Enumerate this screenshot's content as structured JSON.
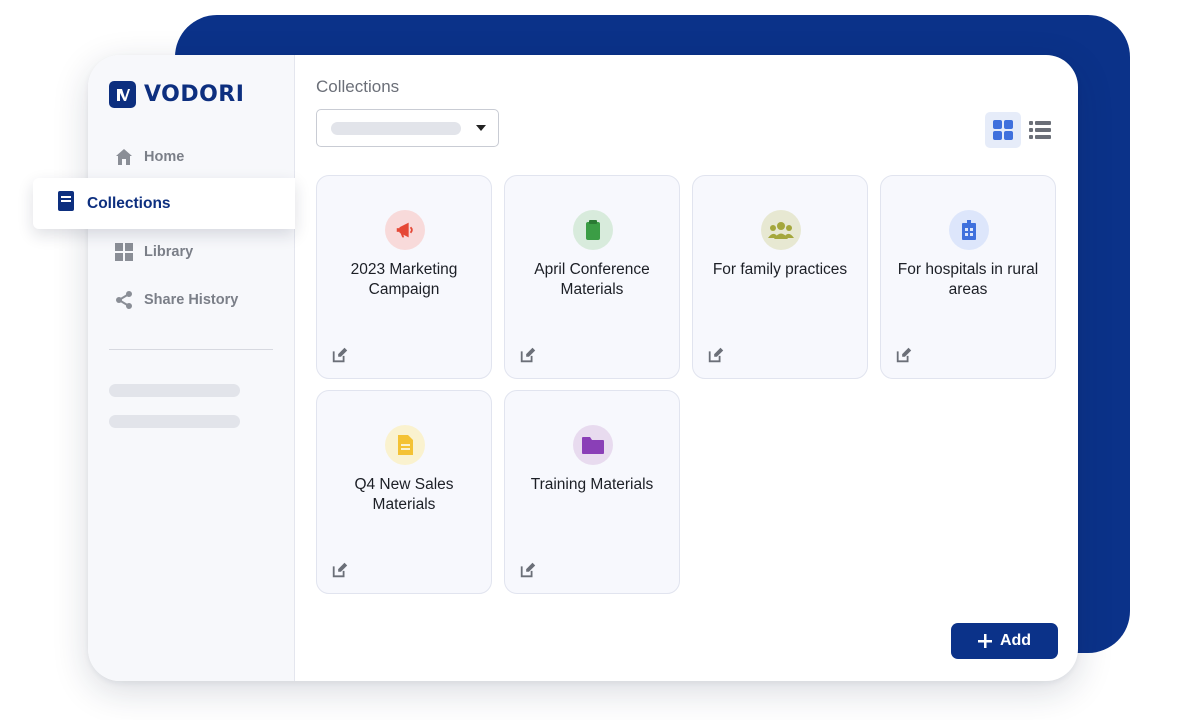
{
  "brand": {
    "name": "VODORI"
  },
  "sidebar": {
    "items": [
      {
        "label": "Home",
        "icon": "home-icon"
      },
      {
        "label": "Collections",
        "icon": "book-icon",
        "active": true
      },
      {
        "label": "Library",
        "icon": "grid-icon"
      },
      {
        "label": "Share History",
        "icon": "share-icon"
      }
    ]
  },
  "main": {
    "title": "Collections",
    "view_modes": [
      "grid",
      "list"
    ],
    "active_view": "grid"
  },
  "cards": [
    {
      "label": "2023 Marketing Campaign",
      "icon": "megaphone-icon",
      "color": "#e54836",
      "bg": "#f8dada"
    },
    {
      "label": "April Conference Materials",
      "icon": "clipboard-icon",
      "color": "#3b9d45",
      "bg": "#d8ebdc"
    },
    {
      "label": "For family practices",
      "icon": "people-icon",
      "color": "#a4a73c",
      "bg": "#e7e8d2"
    },
    {
      "label": "For hospitals in rural areas",
      "icon": "hospital-icon",
      "color": "#3f70dd",
      "bg": "#dde6fb"
    },
    {
      "label": "Q4 New Sales Materials",
      "icon": "document-icon",
      "color": "#f4c234",
      "bg": "#faf2cf"
    },
    {
      "label": "Training Materials",
      "icon": "folder-icon",
      "color": "#8a3fb7",
      "bg": "#e8dbef"
    }
  ],
  "actions": {
    "add_label": "Add"
  },
  "colors": {
    "brand": "#0b3289",
    "accent": "#3f70dd"
  }
}
